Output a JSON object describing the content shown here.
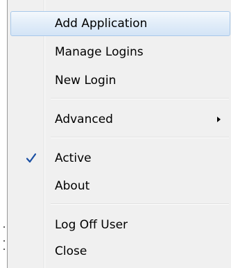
{
  "menu": {
    "items": [
      {
        "label": "Add Application"
      },
      {
        "label": "Manage Logins"
      },
      {
        "label": "New Login"
      },
      {
        "label": "Advanced"
      },
      {
        "label": "Active"
      },
      {
        "label": "About"
      },
      {
        "label": "Log Off User"
      },
      {
        "label": "Close"
      }
    ],
    "highlighted_item": "Add Application",
    "checked_item": "Active",
    "submenu_item": "Advanced"
  },
  "icons": {
    "check": "checkmark-icon",
    "submenu": "submenu-arrow-icon"
  },
  "colors": {
    "menu_background": "#f0f0f0",
    "highlight_border": "#a8c8ea",
    "highlight_fill": "#dce9f7",
    "check_color": "#1a4fa3"
  }
}
